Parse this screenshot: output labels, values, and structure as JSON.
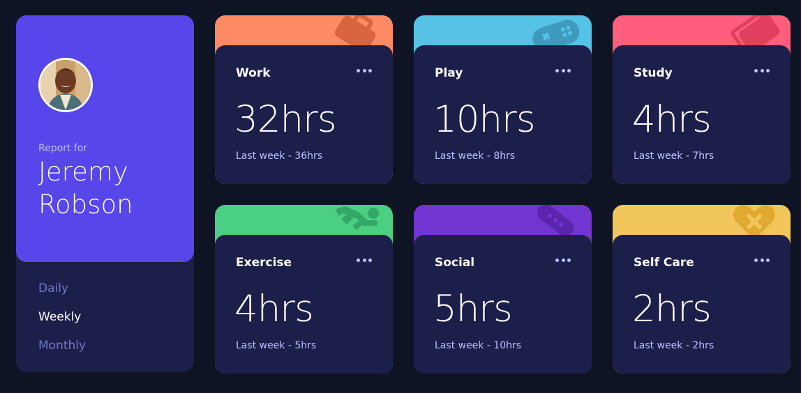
{
  "profile": {
    "report_label": "Report for",
    "name": "Jeremy Robson"
  },
  "periods": [
    {
      "label": "Daily",
      "active": false
    },
    {
      "label": "Weekly",
      "active": true
    },
    {
      "label": "Monthly",
      "active": false
    }
  ],
  "cards": [
    {
      "title": "Work",
      "current": "32hrs",
      "previous": "Last week - 36hrs",
      "color": "#ff8b64",
      "icon": "briefcase-icon"
    },
    {
      "title": "Play",
      "current": "10hrs",
      "previous": "Last week - 8hrs",
      "color": "#55c2e6",
      "icon": "gamepad-icon"
    },
    {
      "title": "Study",
      "current": "4hrs",
      "previous": "Last week - 7hrs",
      "color": "#ff5e7d",
      "icon": "books-icon"
    },
    {
      "title": "Exercise",
      "current": "4hrs",
      "previous": "Last week - 5hrs",
      "color": "#4bcf82",
      "icon": "runner-icon"
    },
    {
      "title": "Social",
      "current": "5hrs",
      "previous": "Last week - 10hrs",
      "color": "#7335d2",
      "icon": "social-icon"
    },
    {
      "title": "Self Care",
      "current": "2hrs",
      "previous": "Last week - 2hrs",
      "color": "#f1c75b",
      "icon": "heart-icon"
    }
  ],
  "colors": {
    "background": "#0e1424",
    "card": "#1c1f4a",
    "profile": "#5746ea",
    "muted": "#bbc0ff"
  }
}
